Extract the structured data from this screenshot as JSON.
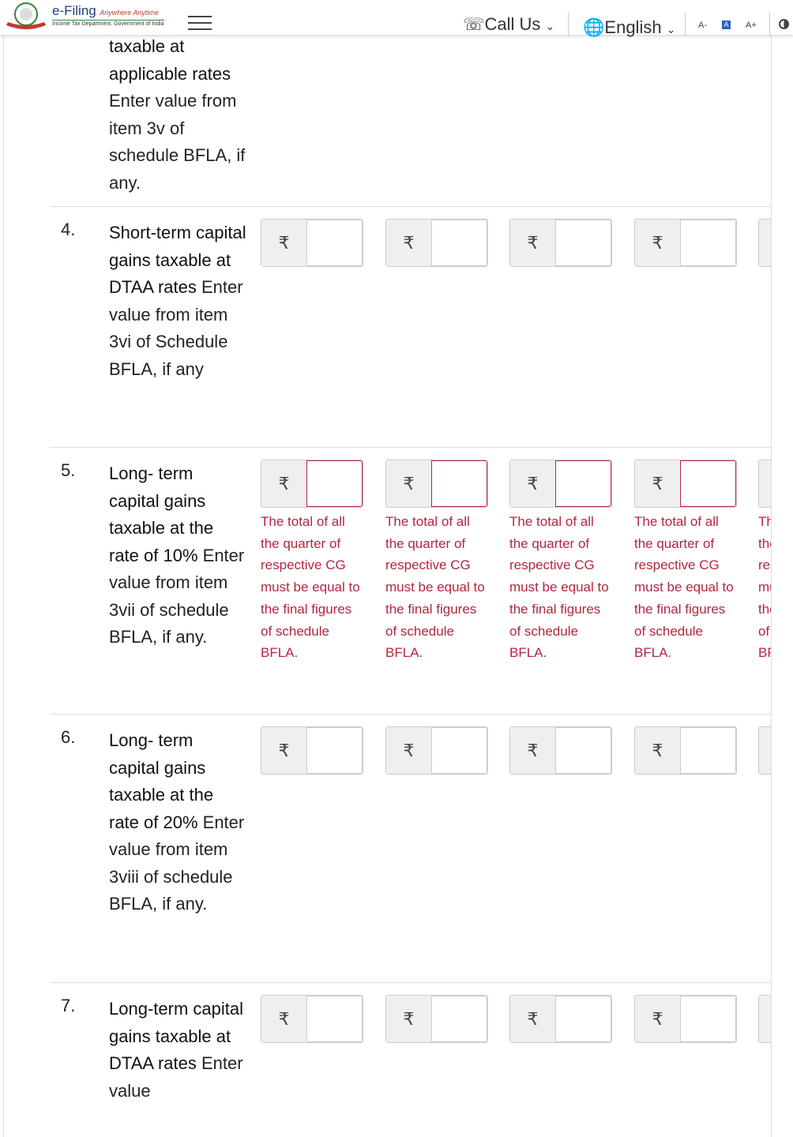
{
  "header": {
    "logo_title": "e-Filing",
    "logo_tagline": "Anywhere Anytime",
    "logo_subtitle": "Income Tax Department, Government of India",
    "call_us": "Call Us",
    "language": "English",
    "font_decrease": "A-",
    "font_normal": "A",
    "font_increase": "A+"
  },
  "currency_symbol": "₹",
  "error_message": "The total of all the quarter of respective CG must be equal to the final figures of schedule BFLA.",
  "rows": [
    {
      "num": "",
      "title": "taxable at applicable rates",
      "desc": "Enter value from item 3v of schedule BFLA, if any.",
      "fields": false,
      "error": false
    },
    {
      "num": "4.",
      "title": "Short-term capital gains taxable at DTAA rates",
      "desc": "Enter value from item 3vi of Schedule BFLA, if any",
      "fields": true,
      "error": false
    },
    {
      "num": "5.",
      "title": "Long- term capital gains taxable at the rate of 10%",
      "desc": "Enter value from item 3vii of schedule BFLA, if any.",
      "fields": true,
      "error": true
    },
    {
      "num": "6.",
      "title": "Long- term capital gains taxable at the rate of 20%",
      "desc": "Enter value from item 3viii of schedule BFLA, if any.",
      "fields": true,
      "error": false
    },
    {
      "num": "7.",
      "title": "Long-term capital gains taxable at DTAA rates",
      "desc": "Enter value",
      "fields": true,
      "error": false
    }
  ]
}
